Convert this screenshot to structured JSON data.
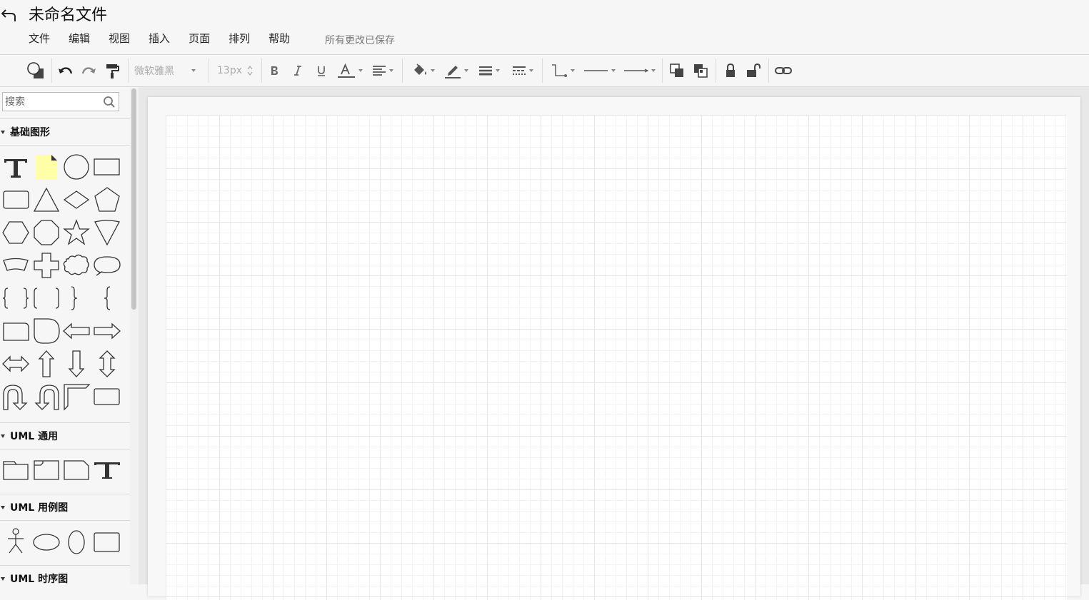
{
  "header": {
    "title": "未命名文件",
    "save_status": "所有更改已保存",
    "menu": [
      "文件",
      "编辑",
      "视图",
      "插入",
      "页面",
      "排列",
      "帮助"
    ]
  },
  "toolbar": {
    "font_family": "微软雅黑",
    "font_size": "13px"
  },
  "sidebar": {
    "search_placeholder": "搜索",
    "sections": {
      "basic": "基础图形",
      "uml_general": "UML 通用",
      "uml_usecase": "UML 用例图",
      "uml_sequence": "UML 时序图"
    }
  },
  "colors": {
    "note_fill": "#ffffa8",
    "accent_text": "#111111",
    "grid_major": "#e6e6e6",
    "grid_minor": "#f3f3f3"
  }
}
